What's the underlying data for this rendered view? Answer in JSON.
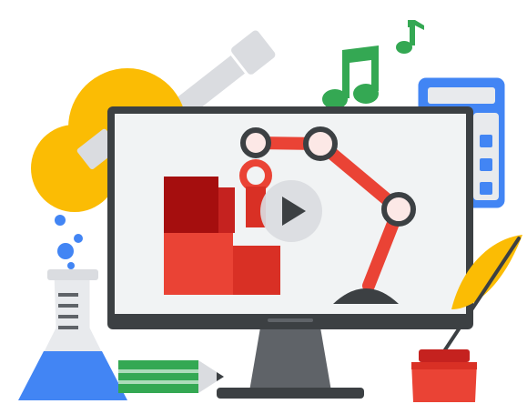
{
  "colors": {
    "outline": "#3c4043",
    "monitor_body": "#3c4043",
    "screen": "#f1f3f4",
    "guitar": "#fbbc04",
    "guitar_neck": "#dadce0",
    "music_note": "#34a853",
    "blue_device": "#4285f4",
    "device_panel": "#e8eaed",
    "flask_liquid": "#4285f4",
    "bubble": "#4285f4",
    "pencil_green": "#34a853",
    "pencil_tip": "#dadce0",
    "feather": "#fbbc04",
    "ink_red": "#ea4335",
    "block_dark_red": "#a50e0e",
    "block_red": "#d93025",
    "block_light_red": "#ea4335",
    "robot_arm": "#ea4335",
    "robot_joint_fill": "#fce8e6",
    "play_button_bg": "#dadce0",
    "play_icon": "#3c4043"
  },
  "icons": {
    "play": "play-icon",
    "guitar": "guitar-icon",
    "music_note": "music-note-icon",
    "calculator": "calculator-icon",
    "flask": "flask-icon",
    "pencil": "pencil-icon",
    "quill": "quill-icon",
    "ink_pot": "ink-pot-icon",
    "robot_arm": "robot-arm-icon",
    "blocks": "blocks-icon"
  }
}
